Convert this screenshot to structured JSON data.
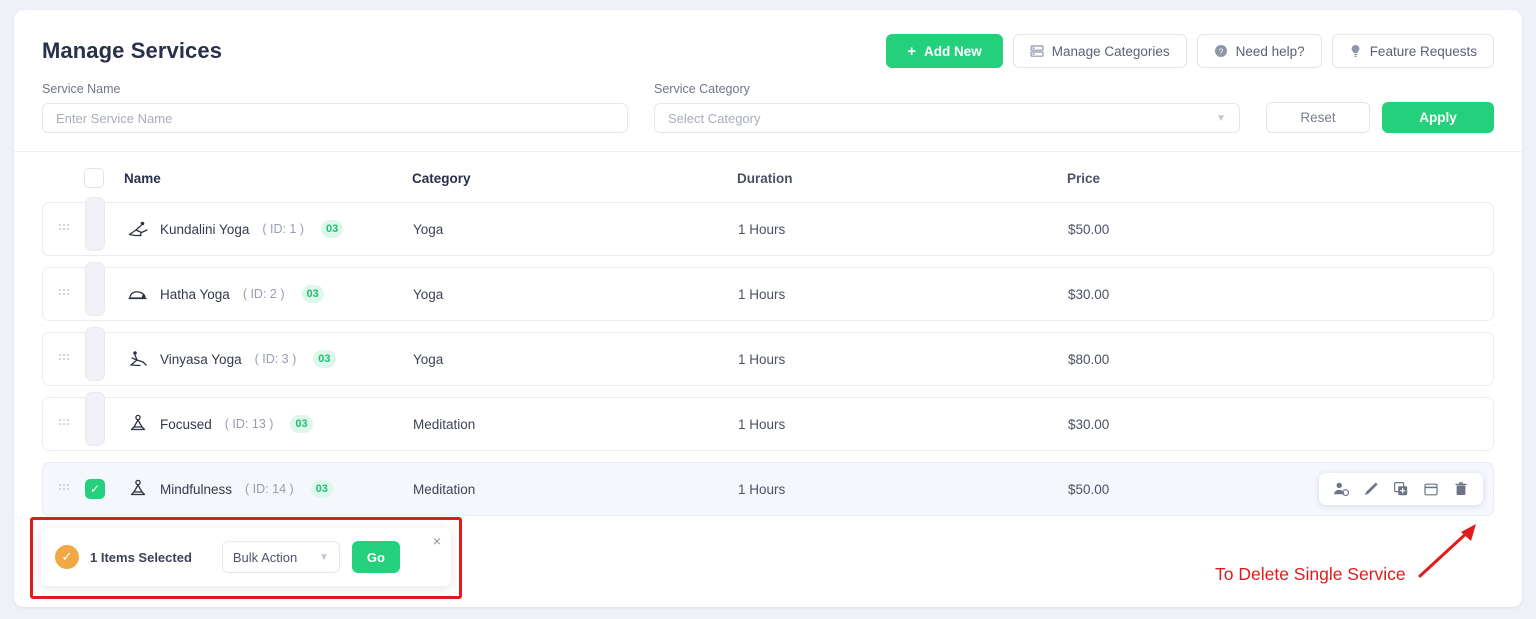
{
  "header": {
    "title": "Manage Services",
    "actions": [
      {
        "label": "Add New",
        "icon": "plus-icon",
        "style": "primary"
      },
      {
        "label": "Manage Categories",
        "icon": "list-icon",
        "style": "default"
      },
      {
        "label": "Need help?",
        "icon": "question-circle-icon",
        "style": "default"
      },
      {
        "label": "Feature Requests",
        "icon": "bulb-icon",
        "style": "default"
      }
    ]
  },
  "filters": {
    "service_name": {
      "label": "Service Name",
      "placeholder": "Enter Service Name",
      "value": ""
    },
    "service_category": {
      "label": "Service Category",
      "placeholder": "Select Category",
      "value": ""
    },
    "reset_label": "Reset",
    "apply_label": "Apply"
  },
  "table": {
    "columns": [
      "Name",
      "Category",
      "Duration",
      "Price"
    ],
    "rows": [
      {
        "name": "Kundalini Yoga",
        "id": "( ID: 1 )",
        "badge": "03",
        "category": "Yoga",
        "duration": "1 Hours",
        "price": "$50.00",
        "selected": false,
        "icon": "yoga-pose-icon"
      },
      {
        "name": "Hatha Yoga",
        "id": "( ID: 2 )",
        "badge": "03",
        "category": "Yoga",
        "duration": "1 Hours",
        "price": "$30.00",
        "selected": false,
        "icon": "yoga-pose-icon"
      },
      {
        "name": "Vinyasa Yoga",
        "id": "( ID: 3 )",
        "badge": "03",
        "category": "Yoga",
        "duration": "1 Hours",
        "price": "$80.00",
        "selected": false,
        "icon": "yoga-pose-icon"
      },
      {
        "name": "Focused",
        "id": "( ID: 13 )",
        "badge": "03",
        "category": "Meditation",
        "duration": "1 Hours",
        "price": "$30.00",
        "selected": false,
        "icon": "meditation-icon"
      },
      {
        "name": "Mindfulness",
        "id": "( ID: 14 )",
        "badge": "03",
        "category": "Meditation",
        "duration": "1 Hours",
        "price": "$50.00",
        "selected": true,
        "icon": "meditation-icon"
      }
    ],
    "row_actions": [
      "assign-user-icon",
      "edit-icon",
      "duplicate-icon",
      "calendar-icon",
      "delete-icon"
    ]
  },
  "bulk_action": {
    "selected_text": "1 Items Selected",
    "select_value": "Bulk Action",
    "go_label": "Go",
    "close_label": "×"
  },
  "annotation": {
    "text": "To Delete Single Service",
    "color": "#e01b1b"
  },
  "colors": {
    "accent_green": "#25d07d",
    "badge_green": "#1fbf74",
    "annotation_red": "#e01b1b",
    "bulk_check_orange": "#f0a945"
  }
}
